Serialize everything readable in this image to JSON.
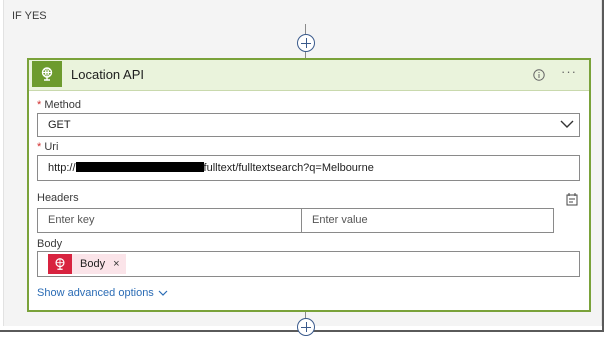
{
  "branch": {
    "label": "IF YES"
  },
  "action": {
    "title": "Location API",
    "icons": {
      "action": "globe-icon",
      "info": "info-icon",
      "more": "more-options-icon"
    },
    "method": {
      "label": "Method",
      "required_mark": "*",
      "value": "GET"
    },
    "uri": {
      "label": "Uri",
      "required_mark": "*",
      "value_prefix": "http://",
      "value_suffix": "fulltext/fulltextsearch?q=Melbourne"
    },
    "headers": {
      "label": "Headers",
      "key_placeholder": "Enter key",
      "value_placeholder": "Enter value"
    },
    "body": {
      "label": "Body",
      "token_label": "Body",
      "token_close": "×"
    },
    "advanced_label": "Show advanced options"
  },
  "colors": {
    "accent_green": "#6d9b2e",
    "token_red": "#d8233f",
    "link_blue": "#2b6cb5"
  }
}
